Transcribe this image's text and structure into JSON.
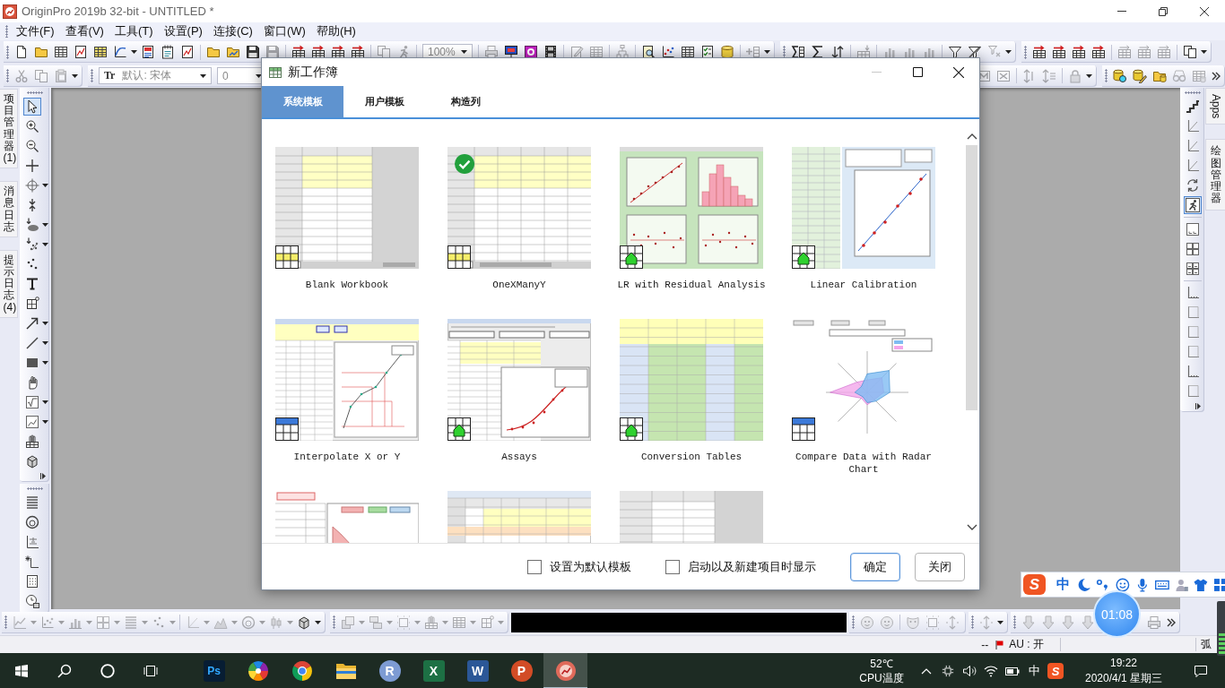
{
  "window": {
    "title": "OriginPro 2019b 32-bit - UNTITLED *"
  },
  "menu": [
    {
      "label": "文件(F)"
    },
    {
      "label": "查看(V)"
    },
    {
      "label": "工具(T)"
    },
    {
      "label": "设置(P)"
    },
    {
      "label": "连接(C)"
    },
    {
      "label": "窗口(W)"
    },
    {
      "label": "帮助(H)"
    }
  ],
  "standard_toolbar": [
    {
      "groups": [
        [
          {
            "kind": "page",
            "disabled": false
          },
          {
            "kind": "folder",
            "disabled": false
          },
          {
            "kind": "table",
            "disabled": false
          },
          {
            "kind": "chart-doc",
            "disabled": false
          },
          {
            "kind": "yellow-table",
            "disabled": false
          },
          {
            "kind": "curve",
            "disabled": false
          },
          {
            "kind": "caret",
            "disabled": false
          },
          {
            "kind": "document",
            "disabled": false
          },
          {
            "kind": "notepad",
            "disabled": false
          },
          {
            "kind": "chart-doc",
            "disabled": false
          }
        ],
        [
          {
            "kind": "folder",
            "disabled": false
          },
          {
            "kind": "folder-chart",
            "disabled": false
          },
          {
            "kind": "floppy",
            "disabled": false
          },
          {
            "kind": "floppy",
            "disabled": true
          }
        ],
        [
          {
            "kind": "table-arrow",
            "disabled": false
          },
          {
            "kind": "table-arrow",
            "disabled": false
          },
          {
            "kind": "table-arrow",
            "disabled": false
          },
          {
            "kind": "table-arrow",
            "disabled": false
          }
        ],
        [
          {
            "kind": "copy",
            "disabled": true
          },
          {
            "kind": "person",
            "disabled": true
          }
        ],
        [
          {
            "kind": "combo",
            "text": "100%",
            "disabled": true
          }
        ],
        [
          {
            "kind": "printer",
            "disabled": true
          },
          {
            "kind": "monitor",
            "disabled": false
          },
          {
            "kind": "purple-screen",
            "disabled": false
          },
          {
            "kind": "film",
            "disabled": false
          }
        ],
        [
          {
            "kind": "pencil",
            "disabled": true
          },
          {
            "kind": "table",
            "disabled": true
          }
        ],
        [
          {
            "kind": "tree",
            "disabled": true
          }
        ],
        [
          {
            "kind": "magdoc",
            "disabled": false
          },
          {
            "kind": "dotchart",
            "disabled": false
          },
          {
            "kind": "table",
            "disabled": false
          },
          {
            "kind": "checkdoc",
            "disabled": false
          },
          {
            "kind": "database",
            "disabled": false
          }
        ],
        [
          {
            "kind": "plus-table",
            "disabled": true
          },
          {
            "kind": "caret",
            "disabled": false
          }
        ]
      ]
    },
    {
      "groups": [
        [
          {
            "kind": "sigma-table",
            "disabled": false
          },
          {
            "kind": "sigma",
            "disabled": false
          },
          {
            "kind": "sort",
            "disabled": false
          }
        ],
        [
          {
            "kind": "digits-table",
            "disabled": true
          }
        ],
        [
          {
            "kind": "bars",
            "disabled": true
          },
          {
            "kind": "bars",
            "disabled": true
          },
          {
            "kind": "bars",
            "disabled": true
          }
        ],
        [
          {
            "kind": "filter",
            "disabled": false
          },
          {
            "kind": "filter-x",
            "disabled": false
          },
          {
            "kind": "filter-arrow",
            "disabled": true
          },
          {
            "kind": "caret",
            "disabled": false
          }
        ]
      ]
    },
    {
      "groups": [
        [
          {
            "kind": "table-arrow",
            "disabled": false
          },
          {
            "kind": "table-arrow",
            "disabled": false
          },
          {
            "kind": "table-arrow",
            "disabled": false
          },
          {
            "kind": "table-arrow",
            "disabled": false
          }
        ],
        [
          {
            "kind": "sync-table",
            "disabled": true
          },
          {
            "kind": "sync-table",
            "disabled": true
          },
          {
            "kind": "sync-table",
            "disabled": true
          }
        ],
        [
          {
            "kind": "copy",
            "disabled": false
          },
          {
            "kind": "caret",
            "disabled": false
          }
        ]
      ]
    }
  ],
  "format_toolbar": [
    {
      "groups": [
        [
          {
            "kind": "scissors",
            "disabled": true
          },
          {
            "kind": "copy",
            "disabled": true
          },
          {
            "kind": "paste",
            "disabled": true
          },
          {
            "kind": "caret",
            "disabled": false
          }
        ]
      ]
    },
    {
      "groups": [
        [
          {
            "kind": "font-combo",
            "glyph": "Tr",
            "text": "默认: 宋体",
            "disabled": true
          },
          {
            "kind": "combo",
            "text": "0",
            "disabled": true
          }
        ]
      ]
    }
  ],
  "worksheet_toolbar": [
    {
      "groups": [
        [
          {
            "kind": "cols-m",
            "disabled": true
          },
          {
            "kind": "cols-x",
            "disabled": true
          }
        ],
        [
          {
            "kind": "updown",
            "disabled": true
          },
          {
            "kind": "updown2",
            "disabled": true
          }
        ],
        [
          {
            "kind": "lock",
            "disabled": true
          },
          {
            "kind": "caret",
            "disabled": false
          }
        ]
      ]
    },
    {
      "groups": [
        [
          {
            "kind": "db-mag",
            "disabled": false
          },
          {
            "kind": "db-pencil",
            "disabled": false
          },
          {
            "kind": "folder-db",
            "disabled": false
          },
          {
            "kind": "glasses",
            "disabled": true
          },
          {
            "kind": "table-db",
            "disabled": true
          },
          {
            "kind": "chevrons",
            "disabled": false
          }
        ]
      ]
    }
  ],
  "left_tabs": [
    {
      "label": "项目管理器 (1)"
    },
    {
      "label": "消息日志"
    },
    {
      "label": "提示日志 (4)"
    }
  ],
  "tool_palettes": [
    {
      "groups": [
        [
          {
            "kind": "cursor",
            "selected": true,
            "menu": false
          },
          {
            "kind": "zoom-in",
            "selected": false,
            "menu": false
          },
          {
            "kind": "zoom-out",
            "selected": false,
            "menu": false
          },
          {
            "kind": "cross",
            "selected": false,
            "menu": false
          },
          {
            "kind": "target",
            "selected": false,
            "menu": true
          },
          {
            "kind": "arrows",
            "selected": false,
            "menu": false
          },
          {
            "kind": "blob",
            "selected": false,
            "menu": true
          },
          {
            "kind": "blob-x",
            "selected": false,
            "menu": true
          },
          {
            "kind": "dots",
            "selected": false,
            "menu": false
          },
          {
            "kind": "tee",
            "selected": false,
            "menu": false
          },
          {
            "kind": "region",
            "selected": false,
            "menu": false
          },
          {
            "kind": "arrow",
            "selected": false,
            "menu": true
          },
          {
            "kind": "line",
            "selected": false,
            "menu": true
          },
          {
            "kind": "rect",
            "selected": false,
            "menu": true
          },
          {
            "kind": "hand",
            "selected": false,
            "menu": false
          },
          {
            "kind": "sqrt-frame",
            "selected": false,
            "menu": true
          },
          {
            "kind": "graph-frame",
            "selected": false,
            "menu": true
          },
          {
            "kind": "hand-table",
            "selected": false,
            "menu": false
          },
          {
            "kind": "cube",
            "selected": false,
            "menu": false
          }
        ]
      ]
    },
    {
      "groups": [
        [
          {
            "kind": "lines",
            "selected": false,
            "menu": false
          },
          {
            "kind": "ring",
            "selected": false,
            "menu": false
          },
          {
            "kind": "abc-frame",
            "selected": false,
            "menu": false
          },
          {
            "kind": "star-axes",
            "selected": false,
            "menu": false
          },
          {
            "kind": "dotted-frame",
            "selected": false,
            "menu": false
          },
          {
            "kind": "clock",
            "selected": false,
            "menu": false
          }
        ]
      ]
    }
  ],
  "graph_palette": {
    "groups": [
      [
        {
          "kind": "steps",
          "selected": false,
          "menu": false
        },
        {
          "kind": "axes",
          "selected": false,
          "menu": false
        },
        {
          "kind": "axes",
          "selected": false,
          "menu": false
        },
        {
          "kind": "axes",
          "selected": false,
          "menu": false
        },
        {
          "kind": "swap",
          "selected": false,
          "menu": false
        },
        {
          "kind": "runner",
          "selected": true,
          "menu": false
        }
      ],
      [
        {
          "kind": "layout1",
          "selected": false,
          "menu": false
        },
        {
          "kind": "layout2",
          "selected": false,
          "menu": false
        },
        {
          "kind": "layout3",
          "selected": false,
          "menu": false
        }
      ],
      [
        {
          "kind": "corner",
          "selected": false,
          "menu": false
        },
        {
          "kind": "corner2",
          "selected": false,
          "menu": false
        },
        {
          "kind": "corner2",
          "selected": false,
          "menu": false
        },
        {
          "kind": "corner2",
          "selected": false,
          "menu": false
        },
        {
          "kind": "corner",
          "selected": false,
          "menu": false
        },
        {
          "kind": "corner2",
          "selected": false,
          "menu": false
        }
      ]
    ]
  },
  "right_tabs": [
    {
      "label": "Apps",
      "kind": "rotated"
    },
    {
      "label": "绘图管理器",
      "kind": "stacked"
    }
  ],
  "dialog": {
    "title": "新工作簿",
    "can_minimize": false,
    "tabs": [
      {
        "label": "系统模板",
        "selected": true
      },
      {
        "label": "用户模板",
        "selected": false
      },
      {
        "label": "构造列",
        "selected": false
      }
    ],
    "templates": [
      {
        "label": "Blank Workbook",
        "kind": "blank-sheet",
        "badge": {
          "kind": "workbook"
        },
        "selected": false
      },
      {
        "label": "OneXManyY",
        "kind": "wide-sheet",
        "badge": {
          "kind": "workbook"
        },
        "selected": true
      },
      {
        "label": "LR with Residual Analysis",
        "kind": "residual-plots",
        "badge": {
          "kind": "analysis"
        },
        "selected": false
      },
      {
        "label": "Linear Calibration",
        "kind": "calibration",
        "badge": {
          "kind": "analysis"
        },
        "selected": false
      },
      {
        "label": "Interpolate X or Y",
        "kind": "interpolation",
        "badge": {
          "kind": "graph"
        },
        "selected": false
      },
      {
        "label": "Assays",
        "kind": "assay-curve",
        "badge": {
          "kind": "analysis"
        },
        "selected": false
      },
      {
        "label": "Conversion Tables",
        "kind": "conversion",
        "badge": {
          "kind": "analysis"
        },
        "selected": false
      },
      {
        "label": "Compare Data with Radar Chart",
        "kind": "radar",
        "badge": {
          "kind": "graph"
        },
        "selected": false
      },
      {
        "kind": "loan-chart",
        "selected": false
      },
      {
        "kind": "colored-sheet",
        "selected": false
      },
      {
        "kind": "plain-sheet",
        "selected": false
      }
    ],
    "options": [
      {
        "label": "设置为默认模板",
        "checked": false
      },
      {
        "label": "启动以及新建项目时显示",
        "checked": false
      }
    ],
    "buttons": [
      {
        "label": "确定",
        "default": true
      },
      {
        "label": "关闭",
        "default": false
      }
    ]
  },
  "bottom_toolbar": {
    "left": [
      {
        "groups": [
          [
            {
              "kind": "line-chart",
              "disabled": true
            },
            {
              "kind": "caret",
              "disabled": true
            },
            {
              "kind": "dotchart",
              "disabled": true
            },
            {
              "kind": "caret",
              "disabled": true
            },
            {
              "kind": "bars",
              "disabled": true
            },
            {
              "kind": "caret",
              "disabled": true
            },
            {
              "kind": "layout2",
              "disabled": true
            },
            {
              "kind": "caret",
              "disabled": true
            },
            {
              "kind": "lines",
              "disabled": true
            },
            {
              "kind": "caret",
              "disabled": true
            },
            {
              "kind": "dots",
              "disabled": true
            },
            {
              "kind": "caret",
              "disabled": true
            }
          ],
          [
            {
              "kind": "axes",
              "disabled": true
            },
            {
              "kind": "caret",
              "disabled": true
            },
            {
              "kind": "mountain",
              "disabled": true
            },
            {
              "kind": "caret",
              "disabled": true
            },
            {
              "kind": "ring",
              "disabled": true
            },
            {
              "kind": "caret",
              "disabled": true
            },
            {
              "kind": "candle",
              "disabled": true
            },
            {
              "kind": "caret",
              "disabled": true
            },
            {
              "kind": "cube",
              "disabled": false
            },
            {
              "kind": "caret",
              "disabled": false
            }
          ]
        ]
      },
      {
        "groups": [
          [
            {
              "kind": "layers",
              "disabled": true
            },
            {
              "kind": "caret",
              "disabled": true
            },
            {
              "kind": "stack",
              "disabled": true
            },
            {
              "kind": "caret",
              "disabled": true
            },
            {
              "kind": "dot-box",
              "disabled": true
            },
            {
              "kind": "caret",
              "disabled": true
            },
            {
              "kind": "hand-table",
              "disabled": true
            },
            {
              "kind": "caret",
              "disabled": true
            },
            {
              "kind": "table",
              "disabled": true
            },
            {
              "kind": "caret",
              "disabled": true
            },
            {
              "kind": "region",
              "disabled": true
            },
            {
              "kind": "caret",
              "disabled": true
            }
          ]
        ]
      }
    ],
    "black_bar": true,
    "right": [
      {
        "groups": [
          [
            {
              "kind": "face",
              "disabled": true
            },
            {
              "kind": "face",
              "disabled": true
            }
          ],
          [
            {
              "kind": "mask",
              "disabled": true
            },
            {
              "kind": "dot-box",
              "disabled": true
            },
            {
              "kind": "dot-arrows",
              "disabled": true
            }
          ]
        ]
      },
      {
        "groups": [
          [
            {
              "kind": "dot-arrows",
              "disabled": true
            },
            {
              "kind": "caret",
              "disabled": false
            }
          ]
        ]
      },
      {
        "groups": [
          [
            {
              "kind": "down-block",
              "disabled": true
            },
            {
              "kind": "down-block",
              "disabled": true
            },
            {
              "kind": "down-block",
              "disabled": true
            },
            {
              "kind": "down-block",
              "disabled": true
            }
          ],
          [
            {
              "kind": "printer",
              "disabled": true
            },
            {
              "kind": "chevrons",
              "disabled": false
            }
          ]
        ]
      }
    ]
  },
  "status_bar": {
    "mode": "--",
    "au": "AU : 开",
    "angle": "弧"
  },
  "ime_bar": {
    "logo": "S",
    "mode": "中"
  },
  "recorder": {
    "time": "01:08"
  },
  "taskbar": {
    "apps": [
      {
        "kind": "navy-tile",
        "glyph": "Ps",
        "active": false
      },
      {
        "kind": "color-wheel",
        "active": false
      },
      {
        "kind": "tricolor-circle",
        "active": false
      },
      {
        "kind": "folder",
        "active": false
      },
      {
        "kind": "blue-circle",
        "glyph": "R",
        "active": false
      },
      {
        "kind": "green-tile",
        "glyph": "X",
        "active": false
      },
      {
        "kind": "blue-tile",
        "glyph": "W",
        "active": false
      },
      {
        "kind": "orange-circle",
        "glyph": "P",
        "active": false
      },
      {
        "kind": "red-circle",
        "active": true
      }
    ],
    "temperature": "52℃",
    "temperature_label": "CPU温度",
    "ime": "中",
    "ime_logo": "S",
    "time": "19:22",
    "date": "2020/4/1 星期三"
  }
}
